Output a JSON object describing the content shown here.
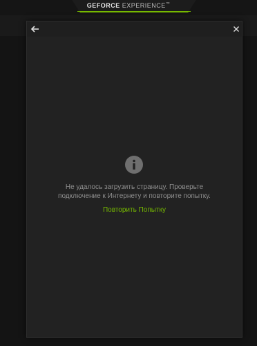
{
  "titlebar": {
    "brand_bold": "GEFORCE",
    "brand_light": "EXPERIENCE",
    "brand_tm": "™"
  },
  "dialog": {
    "back_icon": "arrow-left-icon",
    "close_icon": "close-icon",
    "info_icon": "info-icon",
    "error_line1": "Не удалось загрузить страницу. Проверьте",
    "error_line2": "подключение к Интернету и повторите попытку.",
    "retry_label": "Повторить Попытку"
  },
  "colors": {
    "accent": "#76b900",
    "text_muted": "#8f8f8f",
    "dialog_bg": "#222222"
  }
}
